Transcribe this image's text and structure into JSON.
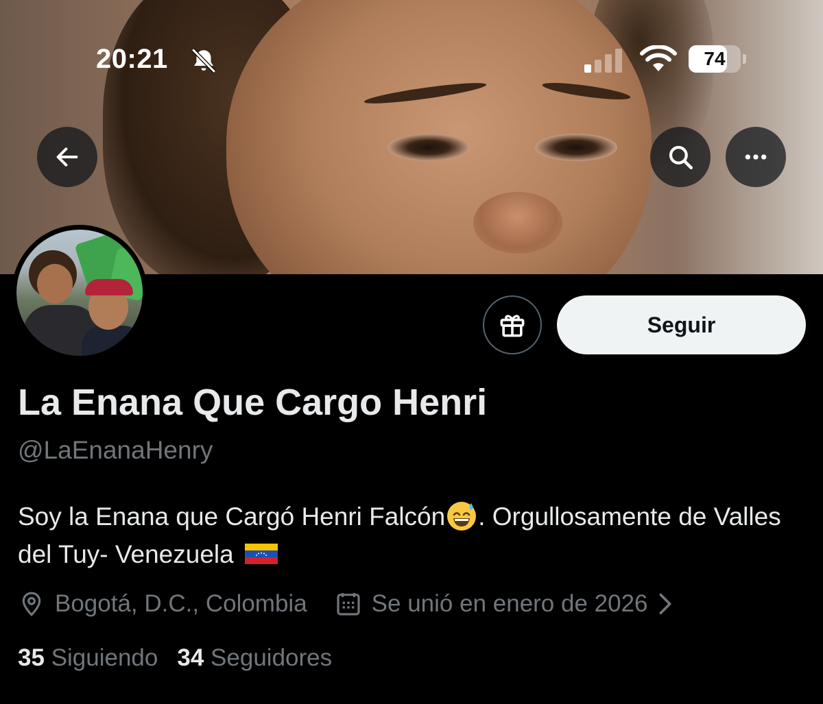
{
  "status_bar": {
    "time": "20:21",
    "battery": "74",
    "battery_level": 0.74
  },
  "header": {
    "back_icon": "arrow-left-icon",
    "search_icon": "search-icon",
    "more_icon": "more-horizontal-icon"
  },
  "actions": {
    "gift_icon": "gift-icon",
    "follow_label": "Seguir"
  },
  "profile": {
    "display_name": "La Enana Que Cargo Henri",
    "handle": "@LaEnanaHenry",
    "bio_text": "Soy la Enana que Cargó Henri Falcón",
    "bio_text_2": ". Orgullosamente de Valles del Tuy- Venezuela ",
    "location": "Bogotá, D.C., Colombia",
    "joined": "Se unió en enero de 2026",
    "following_count": "35",
    "following_label": "Siguiendo",
    "followers_count": "34",
    "followers_label": "Seguidores"
  },
  "colors": {
    "background": "#000000",
    "text_primary": "#e7e9ea",
    "text_secondary": "#71767b",
    "follow_button_bg": "#eff3f4"
  }
}
